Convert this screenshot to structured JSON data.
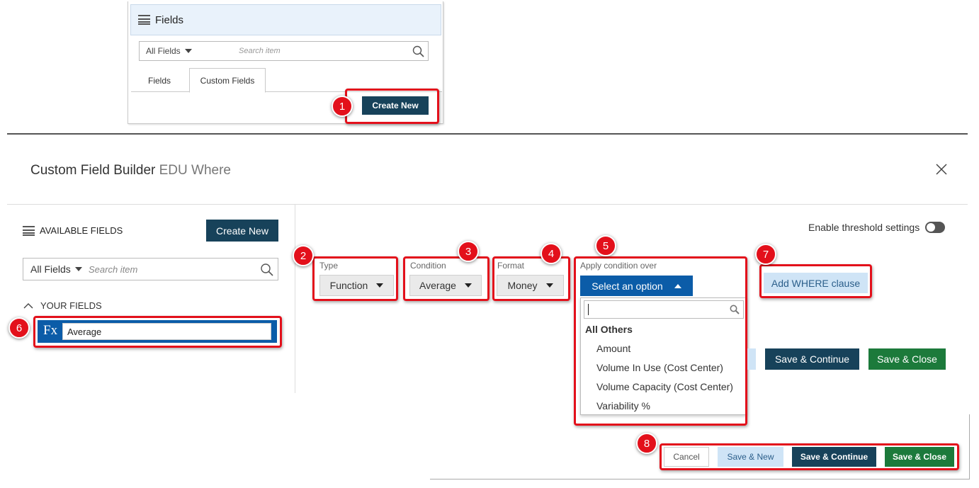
{
  "top_panel": {
    "title": "Fields",
    "filter_label": "All Fields",
    "search_placeholder": "Search item",
    "tabs": [
      "Fields",
      "Custom Fields"
    ],
    "create_button": "Create New"
  },
  "builder": {
    "title": "Custom Field Builder",
    "subtitle": "EDU Where",
    "close_glyph": "×"
  },
  "left_panel": {
    "heading": "AVAILABLE FIELDS",
    "create_button": "Create New",
    "filter_label": "All Fields",
    "search_placeholder": "Search item",
    "section_title": "YOUR FIELDS",
    "field_icon_text": "Fx",
    "field_name": "Average"
  },
  "settings": {
    "threshold_label": "Enable threshold settings",
    "type_label": "Type",
    "type_value": "Function",
    "condition_label": "Condition",
    "condition_value": "Average",
    "format_label": "Format",
    "format_value": "Money",
    "apply_label": "Apply condition over",
    "apply_value": "Select an option",
    "where_button": "Add WHERE clause"
  },
  "dropdown": {
    "group": "All Others",
    "options": [
      "Amount",
      "Volume In Use (Cost Center)",
      "Volume Capacity (Cost Center)",
      "Variability %"
    ]
  },
  "inner_actions": {
    "save_continue": "Save & Continue",
    "save_close": "Save & Close"
  },
  "footer_actions": {
    "cancel": "Cancel",
    "save_new": "Save & New",
    "save_continue": "Save & Continue",
    "save_close": "Save & Close"
  },
  "badges": [
    "1",
    "2",
    "3",
    "4",
    "5",
    "6",
    "7",
    "8"
  ],
  "colors": {
    "annotation_red": "#e3101b",
    "primary_dark": "#17425a",
    "save_green": "#1c7a3b",
    "light_blue": "#cfe4f6",
    "selected_blue": "#0b5ca8"
  }
}
